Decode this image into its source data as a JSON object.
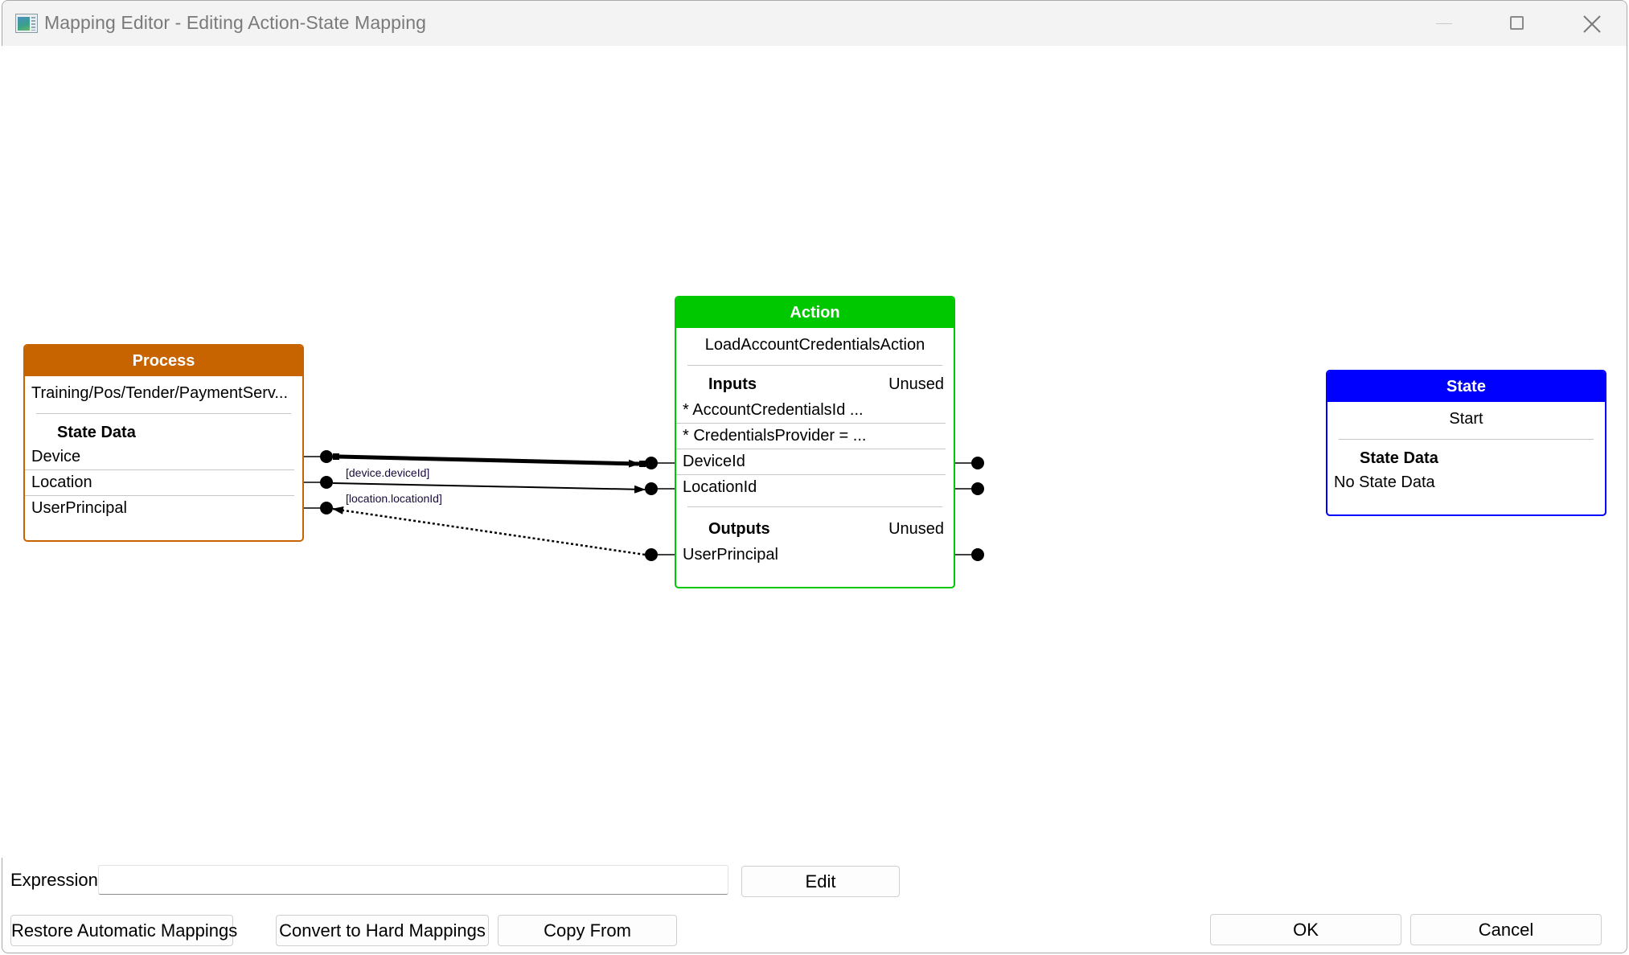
{
  "window": {
    "title": "Mapping Editor - Editing Action-State Mapping",
    "icon": "app-window-icon",
    "controls": [
      "minimize-icon",
      "maximize-icon",
      "close-icon"
    ]
  },
  "colors": {
    "process": "#c86400",
    "action": "#00c800",
    "state": "#0000ff",
    "wire": "#000000",
    "separator": "#c6c6c6"
  },
  "process_node": {
    "header": "Process",
    "name": "Training/Pos/Tender/PaymentServ...",
    "section_title": "State Data",
    "rows": [
      "Device",
      "Location",
      "UserPrincipal"
    ]
  },
  "action_node": {
    "header": "Action",
    "name": "LoadAccountCredentialsAction",
    "inputs": {
      "title": "Inputs",
      "right_label": "Unused",
      "rows": [
        "* AccountCredentialsId ...",
        "* CredentialsProvider = ...",
        "DeviceId",
        "LocationId"
      ]
    },
    "outputs": {
      "title": "Outputs",
      "right_label": "Unused",
      "rows": [
        "UserPrincipal"
      ]
    }
  },
  "state_node": {
    "header": "State",
    "name": "Start",
    "section_title": "State Data",
    "rows": [
      "No State Data"
    ]
  },
  "mappings": [
    {
      "from": "Process.Device",
      "to": "Action.DeviceId",
      "style": "bold-solid",
      "selected": true,
      "label": "[device.deviceId]"
    },
    {
      "from": "Process.Location",
      "to": "Action.LocationId",
      "style": "solid",
      "selected": false,
      "label": "[location.locationId]"
    },
    {
      "from": "Action.UserPrincipal",
      "to": "Process.UserPrincipal",
      "style": "dotted",
      "selected": false,
      "label": ""
    }
  ],
  "expression": {
    "label": "Expression",
    "value": "",
    "placeholder": ""
  },
  "buttons": {
    "edit": "Edit",
    "restore": "Restore Automatic Mappings",
    "convert": "Convert to Hard Mappings",
    "copy_from": "Copy From",
    "ok": "OK",
    "cancel": "Cancel"
  }
}
